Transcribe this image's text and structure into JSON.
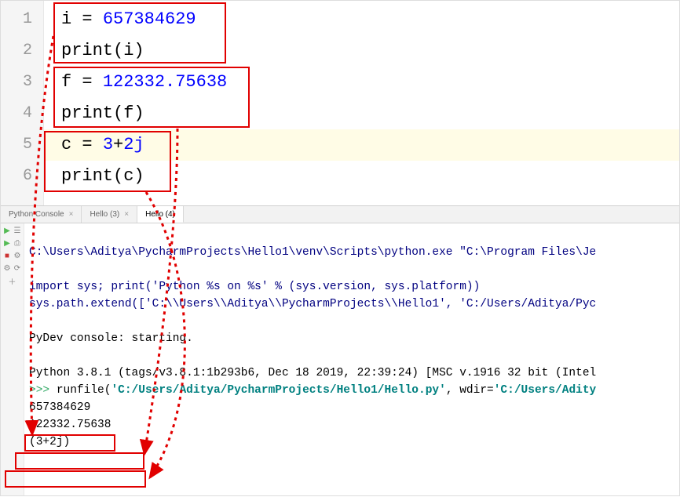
{
  "editor": {
    "lines": {
      "l1": {
        "num": "1",
        "var": "i",
        "eq": " = ",
        "val": "657384629"
      },
      "l2": {
        "num": "2",
        "fn": "print",
        "open": "(",
        "arg": "i",
        "close": ")"
      },
      "l3": {
        "num": "3",
        "var": "f",
        "eq": " = ",
        "val": "122332.75638"
      },
      "l4": {
        "num": "4",
        "fn": "print",
        "open": "(",
        "arg": "f",
        "close": ")"
      },
      "l5": {
        "num": "5",
        "var": "c",
        "eq": " = ",
        "a": "3",
        "plus": "+",
        "b": "2j"
      },
      "l6": {
        "num": "6",
        "fn": "print",
        "open": "(",
        "arg": "c",
        "close": ")"
      }
    }
  },
  "tabs": {
    "t1": "Python Console",
    "t2": "Hello (3)",
    "t3": "Hello (4)",
    "close": "×"
  },
  "console": {
    "exec": "C:\\Users\\Aditya\\PycharmProjects\\Hello1\\venv\\Scripts\\python.exe \"C:\\Program Files\\Je",
    "importline": "import sys; print('Python %s on %s' % (sys.version, sys.platform))",
    "syspath": "sys.path.extend(['C:\\\\Users\\\\Aditya\\\\PycharmProjects\\\\Hello1', 'C:/Users/Aditya/Pyc",
    "pydev": "PyDev console: starting.",
    "pyver": "Python 3.8.1 (tags/v3.8.1:1b293b6, Dec 18 2019, 22:39:24) [MSC v.1916 32 bit (Intel",
    "prompt": ">>> ",
    "runfile": "runfile(",
    "rfarg1": "'C:/Users/Aditya/PycharmProjects/Hello1/Hello.py'",
    "rfcomma": ", wdir=",
    "rfarg2": "'C:/Users/Adity",
    "out1": "657384629",
    "out2": "122332.75638",
    "out3": "(3+2j)"
  }
}
